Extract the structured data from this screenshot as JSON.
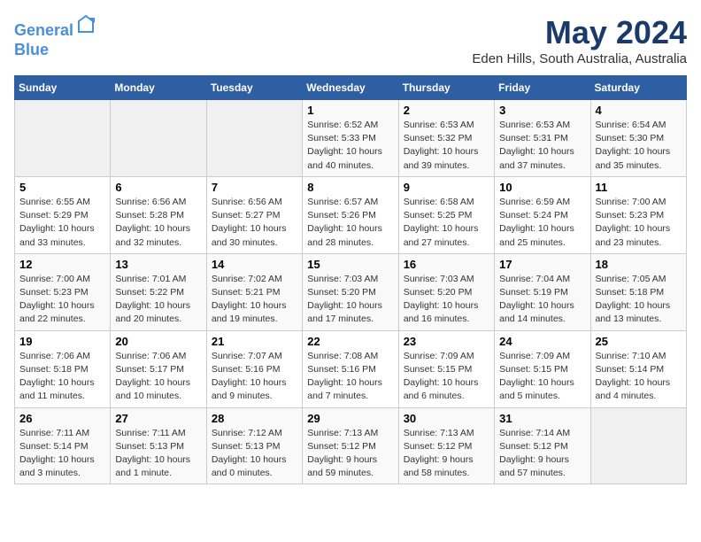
{
  "header": {
    "logo_line1": "General",
    "logo_line2": "Blue",
    "month": "May 2024",
    "location": "Eden Hills, South Australia, Australia"
  },
  "days_of_week": [
    "Sunday",
    "Monday",
    "Tuesday",
    "Wednesday",
    "Thursday",
    "Friday",
    "Saturday"
  ],
  "weeks": [
    [
      {
        "day": "",
        "content": ""
      },
      {
        "day": "",
        "content": ""
      },
      {
        "day": "",
        "content": ""
      },
      {
        "day": "1",
        "content": "Sunrise: 6:52 AM\nSunset: 5:33 PM\nDaylight: 10 hours\nand 40 minutes."
      },
      {
        "day": "2",
        "content": "Sunrise: 6:53 AM\nSunset: 5:32 PM\nDaylight: 10 hours\nand 39 minutes."
      },
      {
        "day": "3",
        "content": "Sunrise: 6:53 AM\nSunset: 5:31 PM\nDaylight: 10 hours\nand 37 minutes."
      },
      {
        "day": "4",
        "content": "Sunrise: 6:54 AM\nSunset: 5:30 PM\nDaylight: 10 hours\nand 35 minutes."
      }
    ],
    [
      {
        "day": "5",
        "content": "Sunrise: 6:55 AM\nSunset: 5:29 PM\nDaylight: 10 hours\nand 33 minutes."
      },
      {
        "day": "6",
        "content": "Sunrise: 6:56 AM\nSunset: 5:28 PM\nDaylight: 10 hours\nand 32 minutes."
      },
      {
        "day": "7",
        "content": "Sunrise: 6:56 AM\nSunset: 5:27 PM\nDaylight: 10 hours\nand 30 minutes."
      },
      {
        "day": "8",
        "content": "Sunrise: 6:57 AM\nSunset: 5:26 PM\nDaylight: 10 hours\nand 28 minutes."
      },
      {
        "day": "9",
        "content": "Sunrise: 6:58 AM\nSunset: 5:25 PM\nDaylight: 10 hours\nand 27 minutes."
      },
      {
        "day": "10",
        "content": "Sunrise: 6:59 AM\nSunset: 5:24 PM\nDaylight: 10 hours\nand 25 minutes."
      },
      {
        "day": "11",
        "content": "Sunrise: 7:00 AM\nSunset: 5:23 PM\nDaylight: 10 hours\nand 23 minutes."
      }
    ],
    [
      {
        "day": "12",
        "content": "Sunrise: 7:00 AM\nSunset: 5:23 PM\nDaylight: 10 hours\nand 22 minutes."
      },
      {
        "day": "13",
        "content": "Sunrise: 7:01 AM\nSunset: 5:22 PM\nDaylight: 10 hours\nand 20 minutes."
      },
      {
        "day": "14",
        "content": "Sunrise: 7:02 AM\nSunset: 5:21 PM\nDaylight: 10 hours\nand 19 minutes."
      },
      {
        "day": "15",
        "content": "Sunrise: 7:03 AM\nSunset: 5:20 PM\nDaylight: 10 hours\nand 17 minutes."
      },
      {
        "day": "16",
        "content": "Sunrise: 7:03 AM\nSunset: 5:20 PM\nDaylight: 10 hours\nand 16 minutes."
      },
      {
        "day": "17",
        "content": "Sunrise: 7:04 AM\nSunset: 5:19 PM\nDaylight: 10 hours\nand 14 minutes."
      },
      {
        "day": "18",
        "content": "Sunrise: 7:05 AM\nSunset: 5:18 PM\nDaylight: 10 hours\nand 13 minutes."
      }
    ],
    [
      {
        "day": "19",
        "content": "Sunrise: 7:06 AM\nSunset: 5:18 PM\nDaylight: 10 hours\nand 11 minutes."
      },
      {
        "day": "20",
        "content": "Sunrise: 7:06 AM\nSunset: 5:17 PM\nDaylight: 10 hours\nand 10 minutes."
      },
      {
        "day": "21",
        "content": "Sunrise: 7:07 AM\nSunset: 5:16 PM\nDaylight: 10 hours\nand 9 minutes."
      },
      {
        "day": "22",
        "content": "Sunrise: 7:08 AM\nSunset: 5:16 PM\nDaylight: 10 hours\nand 7 minutes."
      },
      {
        "day": "23",
        "content": "Sunrise: 7:09 AM\nSunset: 5:15 PM\nDaylight: 10 hours\nand 6 minutes."
      },
      {
        "day": "24",
        "content": "Sunrise: 7:09 AM\nSunset: 5:15 PM\nDaylight: 10 hours\nand 5 minutes."
      },
      {
        "day": "25",
        "content": "Sunrise: 7:10 AM\nSunset: 5:14 PM\nDaylight: 10 hours\nand 4 minutes."
      }
    ],
    [
      {
        "day": "26",
        "content": "Sunrise: 7:11 AM\nSunset: 5:14 PM\nDaylight: 10 hours\nand 3 minutes."
      },
      {
        "day": "27",
        "content": "Sunrise: 7:11 AM\nSunset: 5:13 PM\nDaylight: 10 hours\nand 1 minute."
      },
      {
        "day": "28",
        "content": "Sunrise: 7:12 AM\nSunset: 5:13 PM\nDaylight: 10 hours\nand 0 minutes."
      },
      {
        "day": "29",
        "content": "Sunrise: 7:13 AM\nSunset: 5:12 PM\nDaylight: 9 hours\nand 59 minutes."
      },
      {
        "day": "30",
        "content": "Sunrise: 7:13 AM\nSunset: 5:12 PM\nDaylight: 9 hours\nand 58 minutes."
      },
      {
        "day": "31",
        "content": "Sunrise: 7:14 AM\nSunset: 5:12 PM\nDaylight: 9 hours\nand 57 minutes."
      },
      {
        "day": "",
        "content": ""
      }
    ]
  ]
}
